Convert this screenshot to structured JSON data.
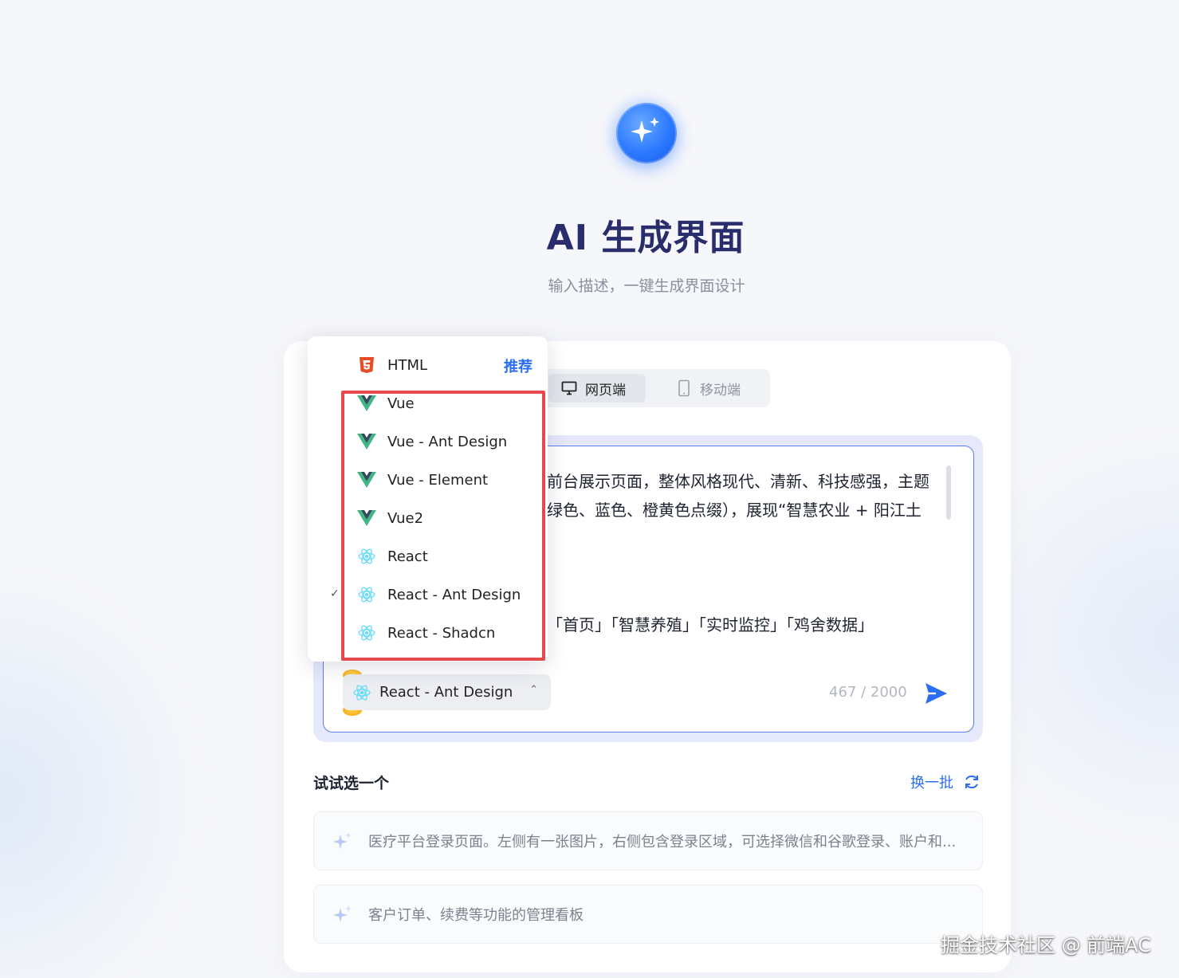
{
  "header": {
    "title": "AI 生成界面",
    "subtitle": "输入描述，一键生成界面设计"
  },
  "platform_tabs": [
    {
      "label": "网页端",
      "icon": "monitor-icon",
      "active": true
    },
    {
      "label": "移动端",
      "icon": "phone-icon",
      "active": false
    }
  ],
  "prompt": {
    "lines": [
      "前台展示页面，整体风格现代、清新、科技感强，主题",
      "绿色、蓝色、橙黄色点缀），展现“智慧农业 + 阳江土",
      "「首页」「智慧养殖」「实时监控」「鸡舍数据」"
    ],
    "counter": "467 / 2000"
  },
  "framework_select": {
    "selected": "React - Ant Design",
    "icon": "react-icon"
  },
  "framework_dropdown": {
    "recommend_label": "推荐",
    "items": [
      {
        "label": "HTML",
        "icon": "html5-icon"
      },
      {
        "label": "Vue",
        "icon": "vue-icon"
      },
      {
        "label": "Vue - Ant Design",
        "icon": "vue-icon"
      },
      {
        "label": "Vue - Element",
        "icon": "vue-icon"
      },
      {
        "label": "Vue2",
        "icon": "vue-icon"
      },
      {
        "label": "React",
        "icon": "react-icon"
      },
      {
        "label": "React - Ant Design",
        "icon": "react-icon"
      },
      {
        "label": "React - Shadcn",
        "icon": "react-icon"
      }
    ]
  },
  "suggestions": {
    "title": "试试选一个",
    "refresh_label": "换一批",
    "items": [
      "医疗平台登录页面。左侧有一张图片，右侧包含登录区域，可选择微信和谷歌登录、账户和...",
      "客户订单、续费等功能的管理看板"
    ]
  },
  "watermark": "掘金技术社区 @ 前端AC",
  "colors": {
    "accent": "#2c6ef2",
    "title": "#2a2d6b",
    "highlight_border": "#e5484d",
    "vue_green": "#41b883",
    "react_blue": "#61dafb",
    "html_orange": "#e44d26"
  }
}
